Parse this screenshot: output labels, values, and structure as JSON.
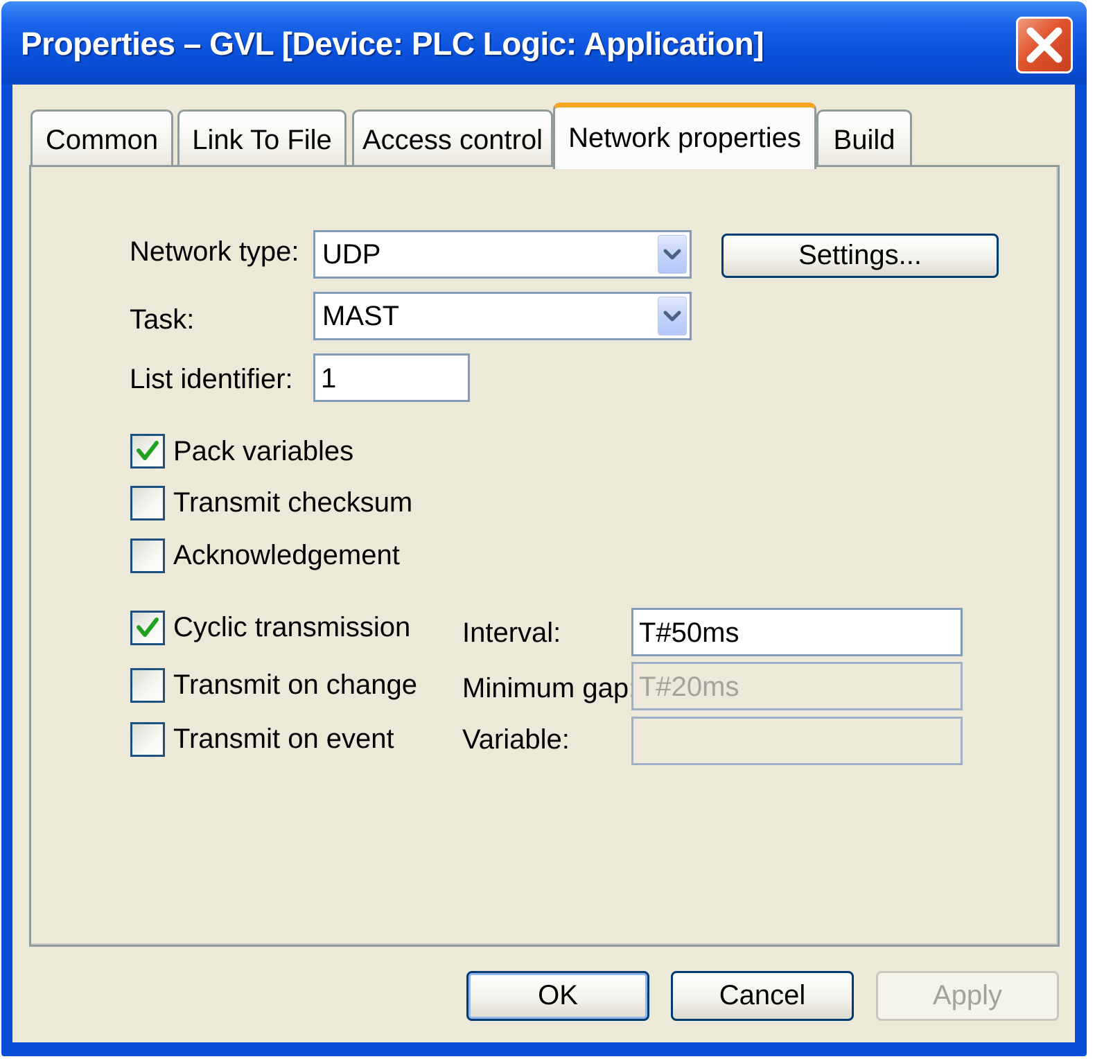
{
  "window": {
    "title": "Properties – GVL [Device: PLC Logic: Application]",
    "close_icon": "close-icon"
  },
  "tabs": [
    {
      "label": "Common",
      "active": false
    },
    {
      "label": "Link To File",
      "active": false
    },
    {
      "label": "Access control",
      "active": false
    },
    {
      "label": "Network properties",
      "active": true
    },
    {
      "label": "Build",
      "active": false
    }
  ],
  "form": {
    "network_type": {
      "label": "Network type:",
      "value": "UDP"
    },
    "settings_button": "Settings...",
    "task": {
      "label": "Task:",
      "value": "MAST"
    },
    "list_identifier": {
      "label": "List identifier:",
      "value": "1"
    },
    "options": [
      {
        "label": "Pack variables",
        "checked": true
      },
      {
        "label": "Transmit checksum",
        "checked": false
      },
      {
        "label": "Acknowledgement",
        "checked": false
      }
    ],
    "transmission": [
      {
        "label": "Cyclic transmission",
        "checked": true
      },
      {
        "label": "Transmit on change",
        "checked": false
      },
      {
        "label": "Transmit on event",
        "checked": false
      }
    ],
    "interval": {
      "label": "Interval:",
      "value": "T#50ms"
    },
    "minimum_gap": {
      "label": "Minimum gap:",
      "value": "T#20ms"
    },
    "variable": {
      "label": "Variable:",
      "value": ""
    }
  },
  "buttons": {
    "ok": "OK",
    "cancel": "Cancel",
    "apply": "Apply"
  },
  "colors": {
    "titlebar": "#0a52dc",
    "dialog_bg": "#ece9d8",
    "active_tab_accent": "#f7a521",
    "check": "#21a121"
  }
}
